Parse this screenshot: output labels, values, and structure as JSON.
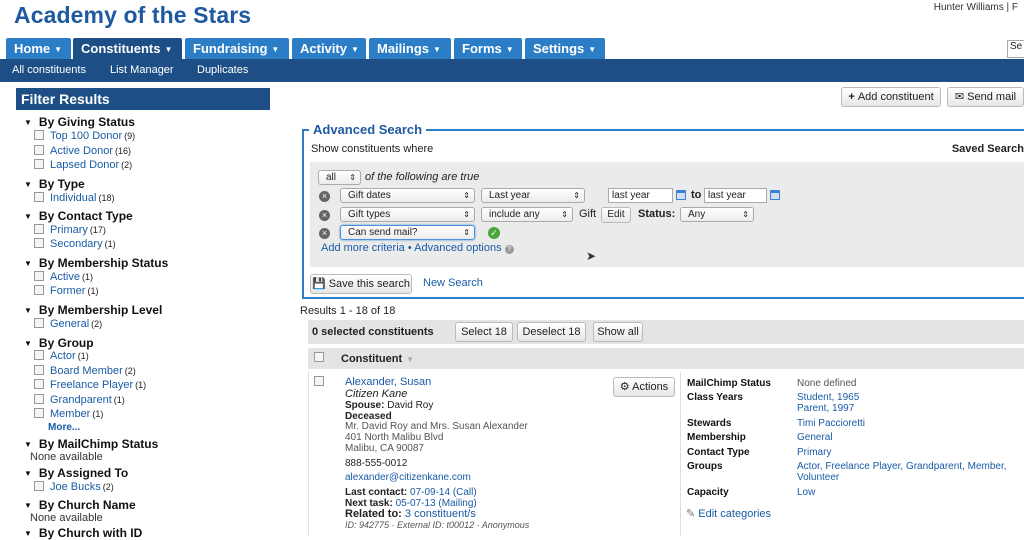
{
  "app": {
    "title": "Academy of the Stars",
    "user": "Hunter Williams | F",
    "search_hint": "Se"
  },
  "nav": {
    "tabs": [
      "Home",
      "Constituents",
      "Fundraising",
      "Activity",
      "Mailings",
      "Forms",
      "Settings"
    ]
  },
  "subnav": {
    "items": [
      "All constituents",
      "List Manager",
      "Duplicates"
    ]
  },
  "toolbar": {
    "add_label": "Add constituent",
    "send_label": "Send mail"
  },
  "filter": {
    "header": "Filter Results",
    "giving_status": {
      "title": "By Giving Status",
      "items": [
        {
          "label": "Top 100 Donor",
          "count": "(9)"
        },
        {
          "label": "Active Donor",
          "count": "(16)"
        },
        {
          "label": "Lapsed Donor",
          "count": "(2)"
        }
      ]
    },
    "type": {
      "title": "By Type",
      "items": [
        {
          "label": "Individual",
          "count": "(18)"
        }
      ]
    },
    "contact_type": {
      "title": "By Contact Type",
      "items": [
        {
          "label": "Primary",
          "count": "(17)"
        },
        {
          "label": "Secondary",
          "count": "(1)"
        }
      ]
    },
    "membership_status": {
      "title": "By Membership Status",
      "items": [
        {
          "label": "Active",
          "count": "(1)"
        },
        {
          "label": "Former",
          "count": "(1)"
        }
      ]
    },
    "membership_level": {
      "title": "By Membership Level",
      "items": [
        {
          "label": "General",
          "count": "(2)"
        }
      ]
    },
    "group": {
      "title": "By Group",
      "items": [
        {
          "label": "Actor",
          "count": "(1)"
        },
        {
          "label": "Board Member",
          "count": "(2)"
        },
        {
          "label": "Freelance Player",
          "count": "(1)"
        },
        {
          "label": "Grandparent",
          "count": "(1)"
        },
        {
          "label": "Member",
          "count": "(1)"
        }
      ],
      "more": "More..."
    },
    "mailchimp": {
      "title": "By MailChimp Status",
      "none": "None available"
    },
    "assigned": {
      "title": "By Assigned To",
      "items": [
        {
          "label": "Joe Bucks",
          "count": "(2)"
        }
      ]
    },
    "church": {
      "title": "By Church Name",
      "none": "None available"
    },
    "church_id": {
      "title": "By Church with ID"
    }
  },
  "advanced": {
    "title": "Advanced Search",
    "show_where": "Show constituents where",
    "saved": "Saved Search",
    "match": "all",
    "match_suffix": "of the following are true",
    "row1": {
      "field": "Gift dates",
      "op": "Last year",
      "from": "last year",
      "to_word": "to",
      "to": "last year"
    },
    "row2": {
      "field": "Gift types",
      "op": "include any",
      "gift": "Gift",
      "edit": "Edit",
      "status_label": "Status:",
      "status": "Any"
    },
    "row3": {
      "field": "Can send mail?"
    },
    "add_more": "Add more criteria",
    "sep": "•",
    "adv_options": "Advanced options",
    "save_search": "Save this search",
    "new_search": "New Search"
  },
  "results": {
    "count": "Results 1 - 18 of 18",
    "selected": "0 selected constituents",
    "select": "Select 18",
    "deselect": "Deselect 18",
    "show_all": "Show all",
    "column": "Constituent"
  },
  "record": {
    "name": "Alexander, Susan",
    "alias": "Citizen Kane",
    "spouse_label": "Spouse:",
    "spouse": "David Roy",
    "deceased": "Deceased",
    "addressee": "Mr. David Roy and Mrs. Susan Alexander",
    "street": "401 North Malibu Blvd",
    "city": "Malibu, CA 90087",
    "phone": "888-555-0012",
    "email": "alexander@citizenkane.com",
    "last_contact_label": "Last contact:",
    "last_contact": "07-09-14 (Call)",
    "next_task_label": "Next task:",
    "next_task": "05-07-13 (Mailing)",
    "related_label": "Related to:",
    "related": "3 constituent/s",
    "ids": "ID: 942775 · External ID: t00012 · Anonymous",
    "actions": "Actions",
    "details": {
      "mailchimp_label": "MailChimp Status",
      "mailchimp": "None defined",
      "class_label": "Class Years",
      "class1": "Student, 1965",
      "class2": "Parent, 1997",
      "stewards_label": "Stewards",
      "stewards": "Timi Paccioretti",
      "membership_label": "Membership",
      "membership": "General",
      "contact_label": "Contact Type",
      "contact": "Primary",
      "groups_label": "Groups",
      "groups1": "Actor, Freelance Player, Grandparent, Member,",
      "groups2": "Volunteer",
      "capacity_label": "Capacity",
      "capacity": "Low",
      "edit_categories": "Edit categories"
    }
  }
}
